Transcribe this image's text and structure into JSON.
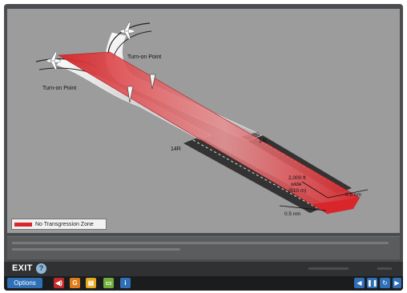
{
  "diagram": {
    "turn_on_upper": "Turn-on Point",
    "turn_on_lower": "Turn-on Point",
    "runway_left": "14L",
    "runway_right": "14R",
    "width_label_ft": "2,000 ft",
    "width_label_wide": "wide",
    "width_label_m": "(610 m)",
    "dim_right": "0.5 nm",
    "dim_bottom": "0.5 nm",
    "legend_label": "No Transgression Zone"
  },
  "exit_bar": {
    "exit_label": "EXIT"
  },
  "toolbar": {
    "options_label": "Options",
    "icons": [
      "audio-icon",
      "glossary-icon",
      "notes-icon",
      "chat-icon",
      "info-icon"
    ]
  },
  "colors": {
    "ntz_red": "#d8262a",
    "runway_dark": "#3a3a3a",
    "accent_blue": "#2e6fb6"
  }
}
